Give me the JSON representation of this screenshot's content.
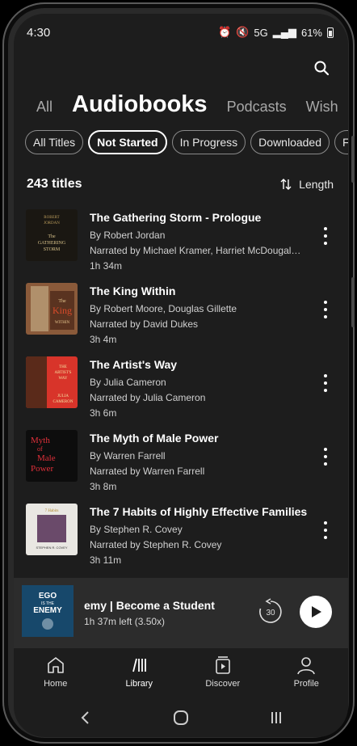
{
  "status": {
    "time": "4:30",
    "network": "5G",
    "battery": "61%"
  },
  "tabs": [
    {
      "label": "All",
      "active": false
    },
    {
      "label": "Audiobooks",
      "active": true
    },
    {
      "label": "Podcasts",
      "active": false
    },
    {
      "label": "Wish",
      "active": false
    }
  ],
  "chips": [
    {
      "label": "All Titles",
      "selected": false
    },
    {
      "label": "Not Started",
      "selected": true
    },
    {
      "label": "In Progress",
      "selected": false
    },
    {
      "label": "Downloaded",
      "selected": false
    },
    {
      "label": "Fi",
      "selected": false
    }
  ],
  "library": {
    "count": "243 titles",
    "sort_label": "Length"
  },
  "books": [
    {
      "title": "The Gathering Storm - Prologue",
      "author": "By Robert Jordan",
      "narrator": "Narrated by Michael Kramer, Harriet McDougal…",
      "duration": "1h 34m",
      "cover_text": [
        "ROBERT",
        "JORDAN",
        "The",
        "GATHERING",
        "STORM"
      ],
      "cover_color": "#1a1712"
    },
    {
      "title": "The King Within",
      "author": "By Robert Moore, Douglas Gillette",
      "narrator": "Narrated by David Dukes",
      "duration": "3h 4m",
      "cover_text": [
        "The",
        "King",
        "WITHIN"
      ],
      "cover_color": "#8a5a3a"
    },
    {
      "title": "The Artist's Way",
      "author": "By Julia Cameron",
      "narrator": "Narrated by Julia Cameron",
      "duration": "3h 6m",
      "cover_text": [
        "THE",
        "ARTIST'S",
        "WAY",
        "JULIA",
        "CAMERON"
      ],
      "cover_color": "#d8342a"
    },
    {
      "title": "The Myth of Male Power",
      "author": "By Warren Farrell",
      "narrator": "Narrated by Warren Farrell",
      "duration": "3h 8m",
      "cover_text": [
        "Myth",
        "of",
        "Male",
        "Power"
      ],
      "cover_color": "#0d0d0d"
    },
    {
      "title": "The 7 Habits of Highly Effective Families",
      "author": "By Stephen R. Covey",
      "narrator": "Narrated by Stephen R. Covey",
      "duration": "3h 11m",
      "cover_text": [
        "7 Habits",
        "STEPHEN R. COVEY"
      ],
      "cover_color": "#e9e7e2"
    }
  ],
  "player": {
    "title": "emy | Become a Student",
    "subtitle": "1h 37m left (3.50x)",
    "rewind_seconds": "30",
    "cover_text": [
      "EGO",
      "IS THE",
      "ENEMY"
    ],
    "cover_color": "#17486b"
  },
  "nav": [
    {
      "label": "Home",
      "icon": "home-icon"
    },
    {
      "label": "Library",
      "icon": "library-icon"
    },
    {
      "label": "Discover",
      "icon": "discover-icon"
    },
    {
      "label": "Profile",
      "icon": "profile-icon"
    }
  ]
}
